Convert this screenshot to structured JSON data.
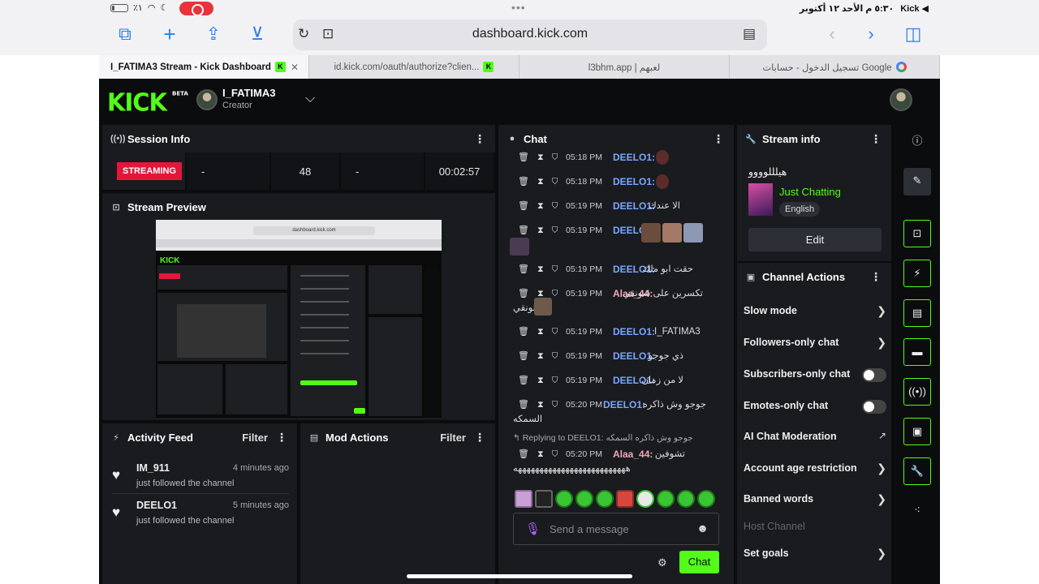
{
  "status_bar": {
    "battery": "٪١",
    "time_date": "٥:٣٠ م  الأحد ١٢ أكتوبر",
    "back_app": "Kick ◀"
  },
  "browser": {
    "url": "dashboard.kick.com",
    "tabs": [
      {
        "label": "I_FATIMA3 Stream - Kick Dashboard",
        "active": true
      },
      {
        "label": "id.kick.com/oauth/authorize?clien..."
      },
      {
        "label": "l3bhm.app | لعبهم"
      },
      {
        "label": "تسجيل الدخول - حسابات Google"
      }
    ]
  },
  "header": {
    "logo": "KICK",
    "logo_badge": "BETA",
    "channel_name": "I_FATIMA3",
    "channel_role": "Creator"
  },
  "session_info": {
    "title": "Session Info",
    "status": "STREAMING",
    "stats": [
      "-",
      "48",
      "-",
      "00:02:57"
    ]
  },
  "stream_preview": {
    "title": "Stream Preview",
    "mini_url": "dashboard.kick.com"
  },
  "activity_feed": {
    "title": "Activity Feed",
    "filter": "Filter",
    "items": [
      {
        "name": "IM_911",
        "time": "4 minutes ago",
        "desc": "just followed the channel"
      },
      {
        "name": "DEELO1",
        "time": "5 minutes ago",
        "desc": "just followed the channel"
      }
    ]
  },
  "mod_actions": {
    "title": "Mod Actions",
    "filter": "Filter"
  },
  "chat": {
    "title": "Chat",
    "messages": [
      {
        "time": "05:18 PM",
        "user": "DEELO1:",
        "text": ""
      },
      {
        "time": "05:18 PM",
        "user": "DEELO1:",
        "text": ""
      },
      {
        "time": "05:19 PM",
        "user": "DEELO1:",
        "text": "الا عندك"
      },
      {
        "time": "05:19 PM",
        "user": "DEELO1:",
        "text": ""
      },
      {
        "time": "05:19 PM",
        "user": "DEELO1:",
        "text": "حقت ابو ملك"
      },
      {
        "time": "05:19 PM",
        "user": "Alaa_44:",
        "text": "تكسرين على شونقي",
        "cont": "لونقي"
      },
      {
        "time": "05:19 PM",
        "user": "DEELO1:",
        "text": "I_FATIMA3"
      },
      {
        "time": "05:19 PM",
        "user": "DEELO1:",
        "text": "ذي جوجو"
      },
      {
        "time": "05:19 PM",
        "user": "DEELO1:",
        "text": "لا من زمان"
      },
      {
        "time": "05:20 PM",
        "user": "DEELO1:",
        "text": "جوجو وش ذاكره",
        "cont": "السمكه"
      },
      {
        "time": "05:20 PM",
        "user": "Alaa_44:",
        "text": "تشوفين",
        "cont": "ههههههههههههههههههههههههههه"
      }
    ],
    "reply_to": "Replying to DEELO1: جوجو وش ذاكره السمكه",
    "input_placeholder": "Send a message",
    "send_label": "Chat"
  },
  "stream_info": {
    "title": "Stream info",
    "stream_title": "هيلللوووو",
    "category": "Just Chatting",
    "language": "English",
    "edit_label": "Edit"
  },
  "channel_actions": {
    "title": "Channel Actions",
    "items": [
      {
        "label": "Slow mode",
        "control": "arrow"
      },
      {
        "label": "Followers-only chat",
        "control": "arrow"
      },
      {
        "label": "Subscribers-only chat",
        "control": "toggle"
      },
      {
        "label": "Emotes-only chat",
        "control": "toggle"
      },
      {
        "label": "AI Chat Moderation",
        "control": "link"
      },
      {
        "label": "Account age restriction",
        "control": "arrow"
      },
      {
        "label": "Banned words",
        "control": "arrow"
      },
      {
        "label": "Host Channel",
        "control": "disabled"
      },
      {
        "label": "Set goals",
        "control": "arrow"
      }
    ]
  },
  "colors": {
    "brand_green": "#53fc18",
    "streaming_red": "#e4163a",
    "panel_bg": "#191b1f",
    "page_bg": "#0b0c0d",
    "username_blue": "#7aa8ff"
  }
}
